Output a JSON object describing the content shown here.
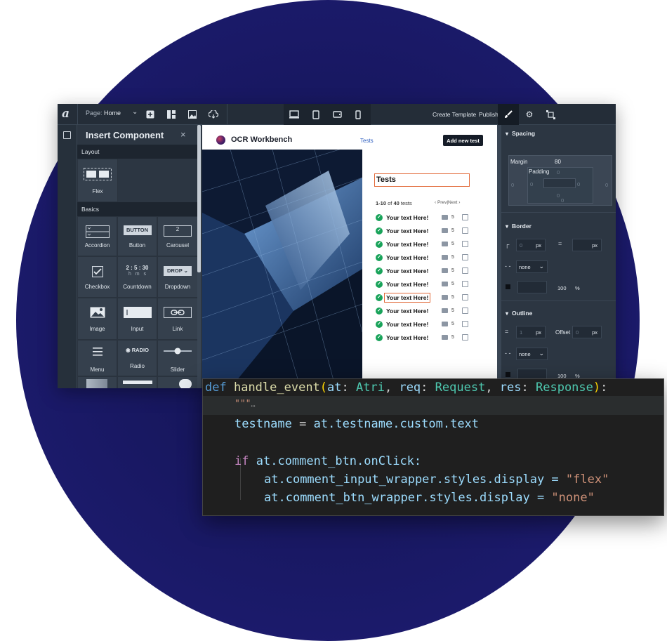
{
  "topbar": {
    "logo": "a",
    "page_label": "Page:",
    "page_value": "Home",
    "create_template": "Create Template",
    "publish": "Publish"
  },
  "insert_panel": {
    "title": "Insert Component",
    "close": "×",
    "sections": [
      {
        "name": "Layout",
        "items": [
          "Flex"
        ]
      },
      {
        "name": "Basics",
        "items": [
          "Accordion",
          "Button",
          "Carousel",
          "Checkbox",
          "Countdown",
          "Dropdown",
          "Image",
          "Input",
          "Link",
          "Menu",
          "Radio",
          "Slider"
        ]
      }
    ],
    "tile_icons": {
      "button_text": "BUTTON",
      "carousel_text": "2",
      "countdown_digits": "2 : 5 : 30",
      "countdown_units": "h   m   s",
      "dropdown_text": "DROP",
      "radio_text": "RADIO"
    }
  },
  "canvas": {
    "brand": "OCR Workbench",
    "nav_link": "Tests",
    "cta": "Add new test",
    "heading": "Tests",
    "count_range": "1-10",
    "count_of": "of",
    "count_total": "40",
    "count_unit": "tests",
    "pager_prev": "‹  Prev",
    "pager_next": "Next  ›",
    "rows": [
      {
        "text": "Your text Here!",
        "comments": "5"
      },
      {
        "text": "Your text Here!",
        "comments": "5"
      },
      {
        "text": "Your text Here!",
        "comments": "5"
      },
      {
        "text": "Your text Here!",
        "comments": "5"
      },
      {
        "text": "Your text Here!",
        "comments": "5"
      },
      {
        "text": "Your text Here!",
        "comments": "5"
      },
      {
        "text": "Your text Here!",
        "comments": "5"
      },
      {
        "text": "Your text Here!",
        "comments": "5"
      },
      {
        "text": "Your text Here!",
        "comments": "5"
      },
      {
        "text": "Your text Here!",
        "comments": "5"
      }
    ]
  },
  "style_panel": {
    "spacing": {
      "title": "Spacing",
      "margin_label": "Margin",
      "margin_value": "80",
      "padding_label": "Padding",
      "zero": "0"
    },
    "border": {
      "title": "Border",
      "radius_value": "0",
      "radius_unit": "px",
      "width_unit": "px",
      "style_value": "none",
      "opacity_value": "100",
      "opacity_unit": "%"
    },
    "outline": {
      "title": "Outline",
      "width_value": "1",
      "width_unit": "px",
      "offset_label": "Offset",
      "offset_value": "0",
      "offset_unit": "px",
      "style_value": "none",
      "opacity_value": "100",
      "opacity_unit": "%"
    }
  },
  "code": {
    "line1": {
      "kw": "def",
      "fn": "handle_event",
      "p_open": "(",
      "a1": "at",
      "c1": ": ",
      "t1": "Atri",
      "s1": ", ",
      "a2": "req",
      "c2": ": ",
      "t2": "Request",
      "s2": ", ",
      "a3": "res",
      "c3": ": ",
      "t3": "Response",
      "p_close": ")",
      "colon": ":"
    },
    "line2": {
      "doc": "\"\"\"",
      "ellipsis": "…"
    },
    "line3": {
      "lhs": "testname",
      "op": " = ",
      "a": "at",
      "rest": ".testname.custom.text"
    },
    "line4": {
      "kw": "if",
      "a": "at",
      "rest": ".comment_btn.onClick:"
    },
    "line5": {
      "a": "at",
      "rest": ".comment_input_wrapper.styles.display = ",
      "str": "\"flex\""
    },
    "line6": {
      "a": "at",
      "rest": ".comment_btn_wrapper.styles.display = ",
      "str": "\"none\""
    }
  },
  "colors": {
    "background_circle": "#1b1a6a",
    "editor_bg": "#2c3642",
    "accent_orange": "#e26a3a",
    "check_green": "#19a35a",
    "link_blue": "#2f5fc0",
    "code_bg": "#1f1f1f"
  },
  "icons": [
    "edit-icon",
    "plus-icon",
    "layout-icon",
    "image-icon",
    "cloud-sync-icon",
    "desktop-icon",
    "tablet-icon",
    "tablet-landscape-icon",
    "phone-icon",
    "brush-icon",
    "gear-icon",
    "transform-icon",
    "close-icon",
    "check-icon",
    "comment-icon",
    "external-link-icon",
    "chevron-down-icon",
    "radius-icon",
    "equals-icon",
    "dash-icon"
  ]
}
